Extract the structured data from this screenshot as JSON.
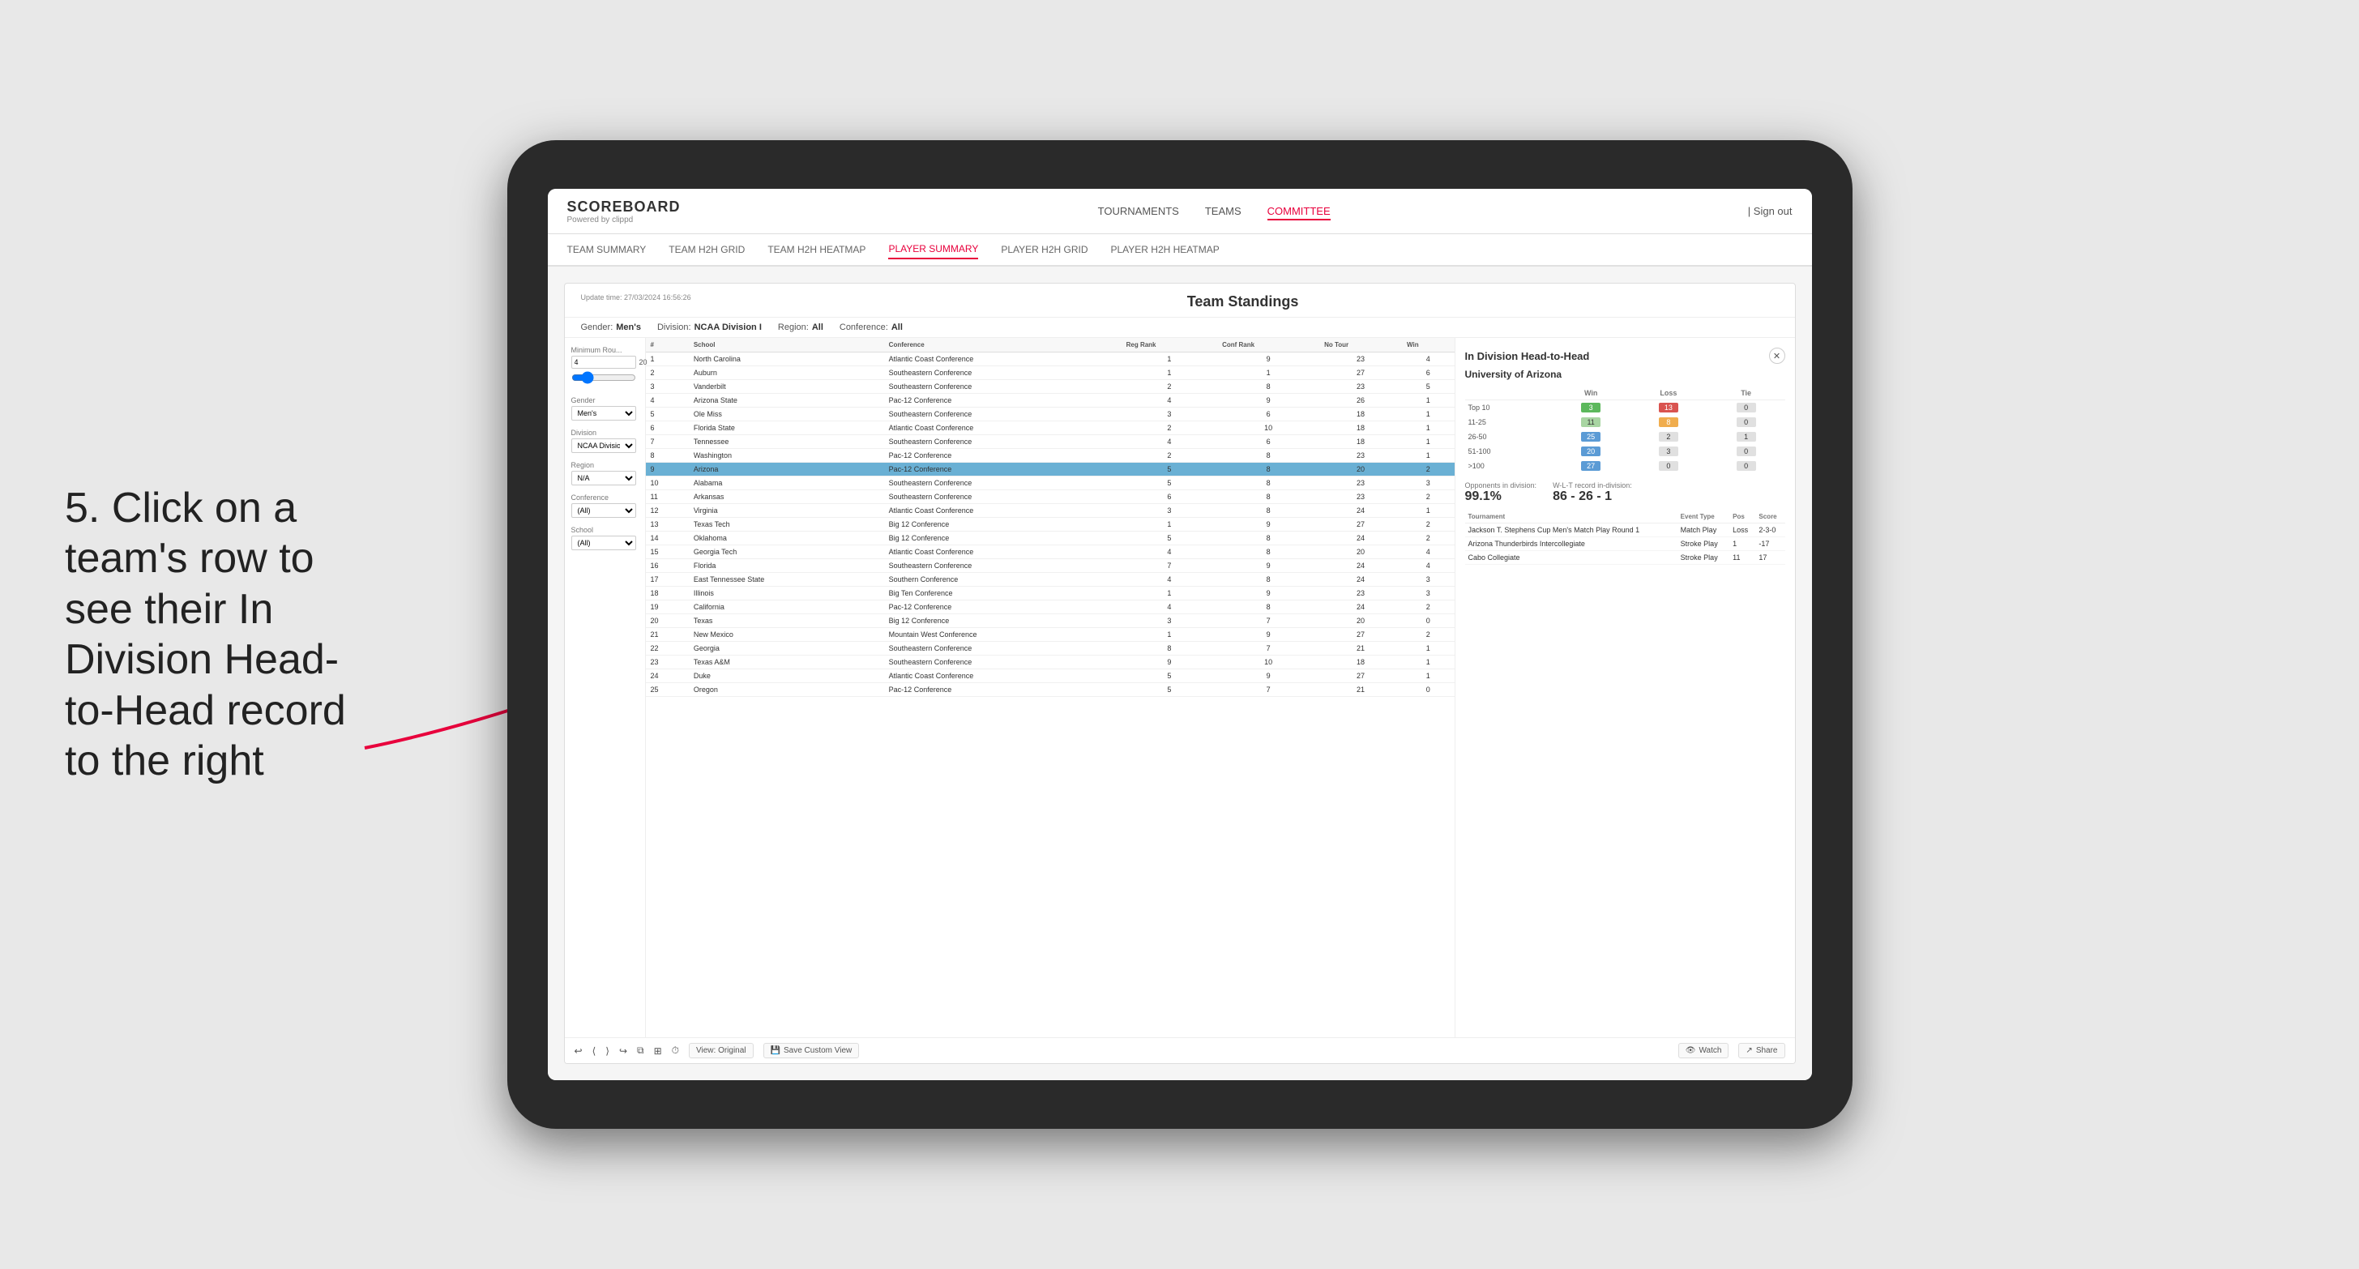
{
  "annotation": {
    "text": "5. Click on a team's row to see their In Division Head-to-Head record to the right"
  },
  "nav": {
    "logo": "SCOREBOARD",
    "logo_sub": "Powered by clippd",
    "links": [
      "TOURNAMENTS",
      "TEAMS",
      "COMMITTEE"
    ],
    "active_link": "COMMITTEE",
    "sign_out": "Sign out"
  },
  "sub_nav": {
    "links": [
      "TEAM SUMMARY",
      "TEAM H2H GRID",
      "TEAM H2H HEATMAP",
      "PLAYER SUMMARY",
      "PLAYER H2H GRID",
      "PLAYER H2H HEATMAP"
    ],
    "active_link": "PLAYER SUMMARY"
  },
  "panel": {
    "update_time": "Update time:\n27/03/2024 16:56:26",
    "title": "Team Standings",
    "gender_label": "Gender:",
    "gender_value": "Men's",
    "division_label": "Division:",
    "division_value": "NCAA Division I",
    "region_label": "Region:",
    "region_value": "All",
    "conference_label": "Conference:",
    "conference_value": "All"
  },
  "sidebar": {
    "min_rou_label": "Minimum Rou...",
    "min_rou_value": "4",
    "gender_label": "Gender",
    "gender_options": [
      "Men's"
    ],
    "division_label": "Division",
    "division_value": "NCAA Division I",
    "region_label": "Region",
    "region_value": "N/A",
    "conference_label": "Conference",
    "conference_value": "(All)",
    "school_label": "School",
    "school_value": "(All)"
  },
  "table": {
    "headers": [
      "#",
      "School",
      "Conference",
      "Reg Rank",
      "Conf Rank",
      "No Tour",
      "Win"
    ],
    "rows": [
      {
        "rank": 1,
        "school": "North Carolina",
        "conference": "Atlantic Coast Conference",
        "reg": 1,
        "conf": 9,
        "tour": 23,
        "win": 4,
        "highlighted": false
      },
      {
        "rank": 2,
        "school": "Auburn",
        "conference": "Southeastern Conference",
        "reg": 1,
        "conf": 1,
        "tour": 27,
        "win": 6,
        "highlighted": false
      },
      {
        "rank": 3,
        "school": "Vanderbilt",
        "conference": "Southeastern Conference",
        "reg": 2,
        "conf": 8,
        "tour": 23,
        "win": 5,
        "highlighted": false
      },
      {
        "rank": 4,
        "school": "Arizona State",
        "conference": "Pac-12 Conference",
        "reg": 4,
        "conf": 9,
        "tour": 26,
        "win": 1,
        "highlighted": false
      },
      {
        "rank": 5,
        "school": "Ole Miss",
        "conference": "Southeastern Conference",
        "reg": 3,
        "conf": 6,
        "tour": 18,
        "win": 1,
        "highlighted": false
      },
      {
        "rank": 6,
        "school": "Florida State",
        "conference": "Atlantic Coast Conference",
        "reg": 2,
        "conf": 10,
        "tour": 18,
        "win": 1,
        "highlighted": false
      },
      {
        "rank": 7,
        "school": "Tennessee",
        "conference": "Southeastern Conference",
        "reg": 4,
        "conf": 6,
        "tour": 18,
        "win": 1,
        "highlighted": false
      },
      {
        "rank": 8,
        "school": "Washington",
        "conference": "Pac-12 Conference",
        "reg": 2,
        "conf": 8,
        "tour": 23,
        "win": 1,
        "highlighted": false
      },
      {
        "rank": 9,
        "school": "Arizona",
        "conference": "Pac-12 Conference",
        "reg": 5,
        "conf": 8,
        "tour": 20,
        "win": 2,
        "highlighted": true
      },
      {
        "rank": 10,
        "school": "Alabama",
        "conference": "Southeastern Conference",
        "reg": 5,
        "conf": 8,
        "tour": 23,
        "win": 3,
        "highlighted": false
      },
      {
        "rank": 11,
        "school": "Arkansas",
        "conference": "Southeastern Conference",
        "reg": 6,
        "conf": 8,
        "tour": 23,
        "win": 2,
        "highlighted": false
      },
      {
        "rank": 12,
        "school": "Virginia",
        "conference": "Atlantic Coast Conference",
        "reg": 3,
        "conf": 8,
        "tour": 24,
        "win": 1,
        "highlighted": false
      },
      {
        "rank": 13,
        "school": "Texas Tech",
        "conference": "Big 12 Conference",
        "reg": 1,
        "conf": 9,
        "tour": 27,
        "win": 2,
        "highlighted": false
      },
      {
        "rank": 14,
        "school": "Oklahoma",
        "conference": "Big 12 Conference",
        "reg": 5,
        "conf": 8,
        "tour": 24,
        "win": 2,
        "highlighted": false
      },
      {
        "rank": 15,
        "school": "Georgia Tech",
        "conference": "Atlantic Coast Conference",
        "reg": 4,
        "conf": 8,
        "tour": 20,
        "win": 4,
        "highlighted": false
      },
      {
        "rank": 16,
        "school": "Florida",
        "conference": "Southeastern Conference",
        "reg": 7,
        "conf": 9,
        "tour": 24,
        "win": 4,
        "highlighted": false
      },
      {
        "rank": 17,
        "school": "East Tennessee State",
        "conference": "Southern Conference",
        "reg": 4,
        "conf": 8,
        "tour": 24,
        "win": 3,
        "highlighted": false
      },
      {
        "rank": 18,
        "school": "Illinois",
        "conference": "Big Ten Conference",
        "reg": 1,
        "conf": 9,
        "tour": 23,
        "win": 3,
        "highlighted": false
      },
      {
        "rank": 19,
        "school": "California",
        "conference": "Pac-12 Conference",
        "reg": 4,
        "conf": 8,
        "tour": 24,
        "win": 2,
        "highlighted": false
      },
      {
        "rank": 20,
        "school": "Texas",
        "conference": "Big 12 Conference",
        "reg": 3,
        "conf": 7,
        "tour": 20,
        "win": 0,
        "highlighted": false
      },
      {
        "rank": 21,
        "school": "New Mexico",
        "conference": "Mountain West Conference",
        "reg": 1,
        "conf": 9,
        "tour": 27,
        "win": 2,
        "highlighted": false
      },
      {
        "rank": 22,
        "school": "Georgia",
        "conference": "Southeastern Conference",
        "reg": 8,
        "conf": 7,
        "tour": 21,
        "win": 1,
        "highlighted": false
      },
      {
        "rank": 23,
        "school": "Texas A&M",
        "conference": "Southeastern Conference",
        "reg": 9,
        "conf": 10,
        "tour": 18,
        "win": 1,
        "highlighted": false
      },
      {
        "rank": 24,
        "school": "Duke",
        "conference": "Atlantic Coast Conference",
        "reg": 5,
        "conf": 9,
        "tour": 27,
        "win": 1,
        "highlighted": false
      },
      {
        "rank": 25,
        "school": "Oregon",
        "conference": "Pac-12 Conference",
        "reg": 5,
        "conf": 7,
        "tour": 21,
        "win": 0,
        "highlighted": false
      }
    ]
  },
  "h2h": {
    "title": "In Division Head-to-Head",
    "team": "University of Arizona",
    "col_win": "Win",
    "col_loss": "Loss",
    "col_tie": "Tie",
    "rows": [
      {
        "range": "Top 10",
        "win": 3,
        "loss": 13,
        "tie": 0,
        "win_class": "cell-green",
        "loss_class": "cell-red",
        "tie_class": "cell-gray"
      },
      {
        "range": "11-25",
        "win": 11,
        "loss": 8,
        "tie": 0,
        "win_class": "cell-lt-green",
        "loss_class": "cell-yellow",
        "tie_class": "cell-gray"
      },
      {
        "range": "26-50",
        "win": 25,
        "loss": 2,
        "tie": 1,
        "win_class": "cell-blue",
        "loss_class": "cell-gray",
        "tie_class": "cell-gray"
      },
      {
        "range": "51-100",
        "win": 20,
        "loss": 3,
        "tie": 0,
        "win_class": "cell-blue",
        "loss_class": "cell-gray",
        "tie_class": "cell-gray"
      },
      {
        "range": ">100",
        "win": 27,
        "loss": 0,
        "tie": 0,
        "win_class": "cell-blue",
        "loss_class": "cell-gray",
        "tie_class": "cell-gray"
      }
    ],
    "opponents_label": "Opponents in division:",
    "opponents_value": "99.1%",
    "record_label": "W-L-T record in-division:",
    "record_value": "86 - 26 - 1",
    "tournament_headers": [
      "Tournament",
      "Event Type",
      "Pos",
      "Score"
    ],
    "tournaments": [
      {
        "name": "Jackson T. Stephens Cup Men's Match Play Round 1",
        "type": "Match Play",
        "pos": "Loss",
        "score": "2-3-0"
      },
      {
        "name": "Arizona Thunderbirds Intercollegiate",
        "type": "Stroke Play",
        "pos": "1",
        "score": "-17"
      },
      {
        "name": "Cabo Collegiate",
        "type": "Stroke Play",
        "pos": "11",
        "score": "17"
      }
    ]
  },
  "toolbar": {
    "undo": "↩",
    "redo": "↪",
    "view_original": "View: Original",
    "save_custom": "Save Custom View",
    "watch": "Watch",
    "share": "Share"
  }
}
